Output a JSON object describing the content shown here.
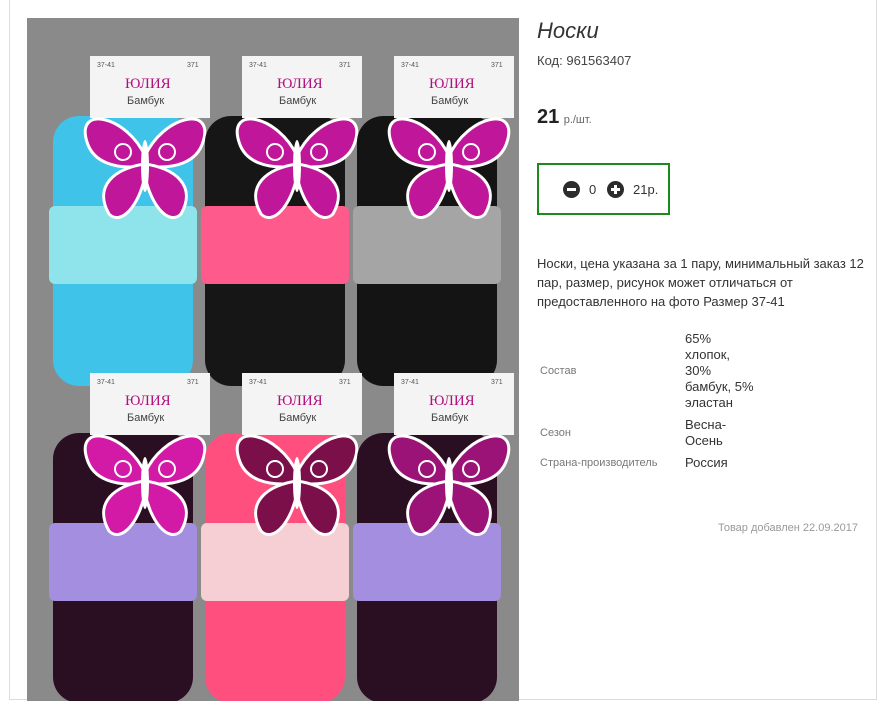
{
  "product": {
    "title": "Носки",
    "code_label": "Код:",
    "code_value": "961563407",
    "price_value": "21",
    "price_unit": "р./шт."
  },
  "cart": {
    "minus_icon": "minus-circle-icon",
    "plus_icon": "plus-circle-icon",
    "quantity": "0",
    "sum": "21р.",
    "accent_color": "#1e8a1e"
  },
  "description": "Носки, цена указана за 1 пару, минимальный заказ 12 пар, размер, рисунок может отличаться от предоставленного на фото Размер 37-41",
  "properties": [
    {
      "name": "Состав",
      "value": "65% хлопок, 30% бамбук, 5% эластан"
    },
    {
      "name": "Сезон",
      "value": "Весна-Осень"
    },
    {
      "name": "Страна-производитель",
      "value": "Россия"
    }
  ],
  "added_text": "Товар добавлен 22.09.2017",
  "photo": {
    "tag_brand": "ЮЛИЯ",
    "tag_material": "Бамбук",
    "tag_size": "37-41",
    "tag_number": "371",
    "socks": [
      {
        "body": "#3fc3e8",
        "band": "#8fe3ea",
        "tag_color": "#c0179a"
      },
      {
        "body": "#161616",
        "band": "#ff5a8c",
        "tag_color": "#c0179a"
      },
      {
        "body": "#141414",
        "band": "#a5a5a5",
        "tag_color": "#c0179a"
      },
      {
        "body": "#2a0f22",
        "band": "#a48ee0",
        "tag_color": "#d31aa6"
      },
      {
        "body": "#ff4f7e",
        "band": "#f6cfd5",
        "tag_color": "#7a0f4a"
      },
      {
        "body": "#2a0f22",
        "band": "#a48ee0",
        "tag_color": "#9c1378"
      }
    ]
  }
}
